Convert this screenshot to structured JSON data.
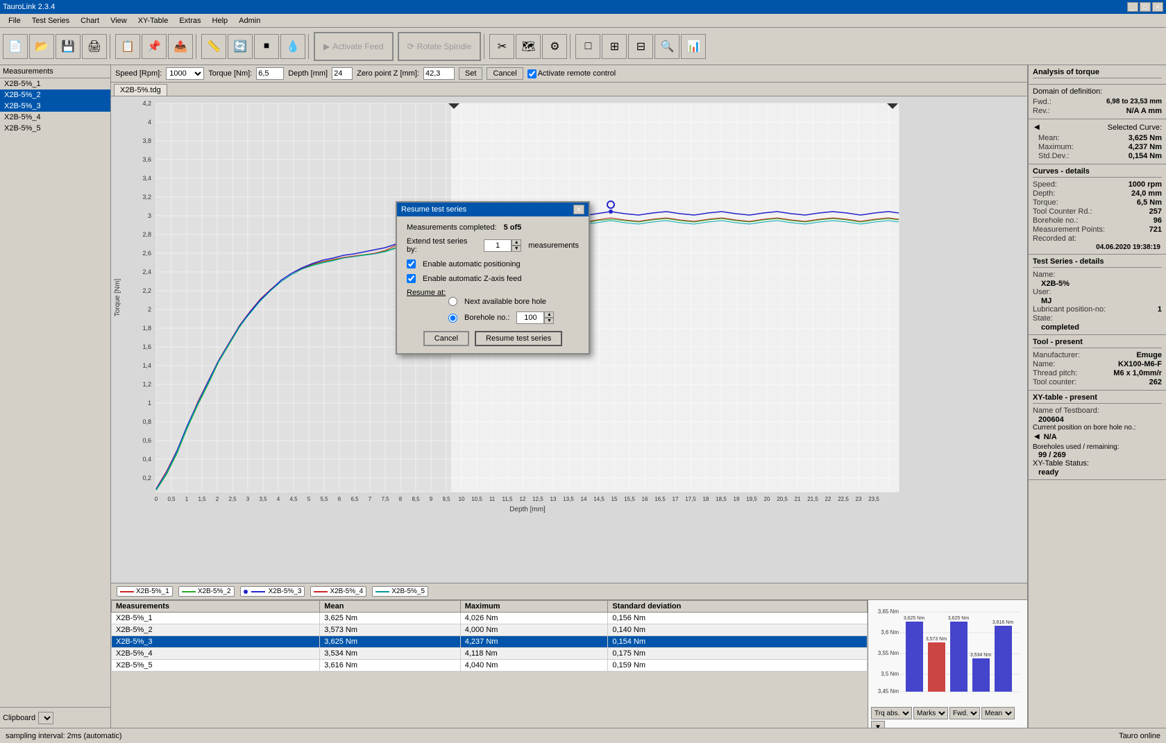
{
  "app": {
    "title": "TauroLink 2.3.4",
    "titlebar_buttons": [
      "_",
      "□",
      "×"
    ]
  },
  "menubar": {
    "items": [
      "File",
      "Test Series",
      "Chart",
      "View",
      "XY-Table",
      "Extras",
      "Help",
      "Admin"
    ]
  },
  "toolbar": {
    "activate_feed_label": "Activate Feed",
    "rotate_spindle_label": "Rotate Spindle"
  },
  "control_bar": {
    "speed_label": "Speed [Rpm]:",
    "speed_value": "1000",
    "torque_label": "Torque [Nm]:",
    "torque_value": "6,5",
    "depth_label": "Depth [mm]",
    "depth_value": "24",
    "zero_z_label": "Zero point Z [mm]:",
    "zero_z_value": "42,3",
    "set_label": "Set",
    "cancel_label": "Cancel",
    "remote_control_label": "Activate remote control",
    "remote_control_checked": true
  },
  "measurements_panel": {
    "header": "Measurements",
    "items": [
      "X2B-5%_1",
      "X2B-5%_2",
      "X2B-5%_3",
      "X2B-5%_4",
      "X2B-5%_5"
    ],
    "selected_index": 2,
    "clipboard_label": "Clipboard"
  },
  "tab": {
    "label": "X2B-5%.tdg"
  },
  "chart": {
    "y_label": "Torque [Nm]",
    "x_label": "Depth [mm]",
    "y_ticks": [
      "0,2",
      "0,4",
      "0,6",
      "0,8",
      "1",
      "1,2",
      "1,4",
      "1,6",
      "1,8",
      "2",
      "2,2",
      "2,4",
      "2,6",
      "2,8",
      "3",
      "3,2",
      "3,4",
      "3,6",
      "3,8",
      "4",
      "4,2"
    ],
    "x_ticks": [
      "0",
      "0,5",
      "1",
      "1,5",
      "2",
      "2,5",
      "3",
      "3,5",
      "4",
      "4,5",
      "5",
      "5,5",
      "6",
      "6,5",
      "7",
      "7,5",
      "8",
      "8,5",
      "9",
      "9,5",
      "10",
      "10,5",
      "11",
      "11,5",
      "12",
      "12,5",
      "13",
      "13,5",
      "14",
      "14,5",
      "15",
      "15,5",
      "16",
      "16,5",
      "17",
      "17,5",
      "18",
      "18,5",
      "19",
      "19,5",
      "20",
      "20,5",
      "21",
      "21,5",
      "22",
      "22,5",
      "23",
      "23,5"
    ]
  },
  "legend": {
    "items": [
      {
        "label": "X2B-5%_1",
        "color": "#cc0000"
      },
      {
        "label": "X2B-5%_2",
        "color": "#00aa00"
      },
      {
        "label": "X2B-5%_3",
        "color": "#0000cc",
        "has_dot": true
      },
      {
        "label": "X2B-5%_4",
        "color": "#cc0000"
      },
      {
        "label": "X2B-5%_5",
        "color": "#009999"
      }
    ]
  },
  "data_table": {
    "headers": [
      "Measurements",
      "Mean",
      "Maximum",
      "Standard deviation"
    ],
    "rows": [
      {
        "name": "X2B-5%_1",
        "mean": "3,625 Nm",
        "maximum": "4,026 Nm",
        "std_dev": "0,156 Nm"
      },
      {
        "name": "X2B-5%_2",
        "mean": "3,573 Nm",
        "maximum": "4,000 Nm",
        "std_dev": "0,140 Nm"
      },
      {
        "name": "X2B-5%_3",
        "mean": "3,625 Nm",
        "maximum": "4,237 Nm",
        "std_dev": "0,154 Nm"
      },
      {
        "name": "X2B-5%_4",
        "mean": "3,534 Nm",
        "maximum": "4,118 Nm",
        "std_dev": "0,175 Nm"
      },
      {
        "name": "X2B-5%_5",
        "mean": "3,616 Nm",
        "maximum": "4,040 Nm",
        "std_dev": "0,159 Nm"
      }
    ],
    "selected_row": 2
  },
  "bar_chart": {
    "bars": [
      {
        "label": "3,625 Nm",
        "value": 3.625,
        "color": "#4444cc"
      },
      {
        "label": "3,573 Nm",
        "value": 3.573,
        "color": "#cc4444"
      },
      {
        "label": "3,625 Nm",
        "value": 3.625,
        "color": "#4444cc"
      },
      {
        "label": "3,534 Nm",
        "value": 3.534,
        "color": "#4444cc"
      },
      {
        "label": "3,616 Nm",
        "value": 3.616,
        "color": "#4444cc"
      }
    ],
    "top_labels": [
      "3,625 Nm",
      "3,625 Nm",
      "3,616 Nm"
    ],
    "y_ticks": [
      "3,45 Nm",
      "3,5 Nm",
      "3,55 Nm",
      "3,6 Nm",
      "3,65 Nm"
    ],
    "dropdowns": [
      "Trq abs.",
      "Marks",
      "Fwd.",
      "Mean"
    ]
  },
  "analysis": {
    "title": "Analysis of torque",
    "domain": {
      "title": "Domain of definition:",
      "fwd_label": "Fwd.:",
      "fwd_value": "6,98 to 23,53 mm",
      "rev_label": "Rev.:",
      "rev_value": "N/A  A mm"
    },
    "selected_curve": {
      "title": "Selected Curve:",
      "mean_label": "Mean:",
      "mean_value": "3,625  Nm",
      "maximum_label": "Maximum:",
      "maximum_value": "4,237  Nm",
      "std_dev_label": "Std.Dev.:",
      "std_dev_value": "0,154  Nm"
    },
    "curves_details": {
      "title": "Curves - details",
      "speed_label": "Speed:",
      "speed_value": "1000  rpm",
      "depth_label": "Depth:",
      "depth_value": "24,0  mm",
      "torque_label": "Torque:",
      "torque_value": "6,5  Nm",
      "tool_counter_label": "Tool Counter Rd.:",
      "tool_counter_value": "257",
      "borehole_label": "Borehole no.:",
      "borehole_value": "96",
      "meas_points_label": "Measurement Points:",
      "meas_points_value": "721",
      "recorded_label": "Recorded at:",
      "recorded_value": "04.06.2020 19:38:19"
    },
    "test_series": {
      "title": "Test Series - details",
      "name_label": "Name:",
      "name_value": "X2B-5%",
      "user_label": "User:",
      "user_value": "MJ",
      "lubricant_label": "Lubricant position-no:",
      "lubricant_value": "1",
      "state_label": "State:",
      "state_value": "completed"
    },
    "tool": {
      "title": "Tool - present",
      "manufacturer_label": "Manufacturer:",
      "manufacturer_value": "Emuge",
      "name_label": "Name:",
      "name_value": "KX100-M6-F",
      "thread_pitch_label": "Thread pitch:",
      "thread_pitch_value": "M6 x 1,0mm/r",
      "tool_counter_label": "Tool counter:",
      "tool_counter_value": "262"
    },
    "xy_table": {
      "title": "XY-table - present",
      "testboard_label": "Name of Testboard:",
      "testboard_value": "200604",
      "position_label": "Current position on bore hole no.:",
      "position_value": "N/A",
      "boreholes_label": "Boreholes used / remaining:",
      "boreholes_value": "99 / 269",
      "status_label": "XY-Table Status:",
      "status_value": "ready"
    }
  },
  "modal": {
    "title": "Resume test series",
    "measurements_completed_label": "Measurements completed:",
    "measurements_completed_value": "5 of5",
    "extend_label": "Extend test series by:",
    "extend_value": "1",
    "extend_unit": "measurements",
    "enable_positioning_label": "Enable automatic positioning",
    "enable_positioning_checked": true,
    "enable_z_feed_label": "Enable automatic Z-axis feed",
    "enable_z_feed_checked": true,
    "resume_at_label": "Resume at:",
    "next_bore_label": "Next available bore hole",
    "borehole_no_label": "Borehole no.:",
    "borehole_no_value": "100",
    "borehole_selected": true,
    "cancel_label": "Cancel",
    "resume_label": "Resume test series"
  },
  "statusbar": {
    "left": "sampling interval: 2ms (automatic)",
    "right": "Tauro online"
  }
}
